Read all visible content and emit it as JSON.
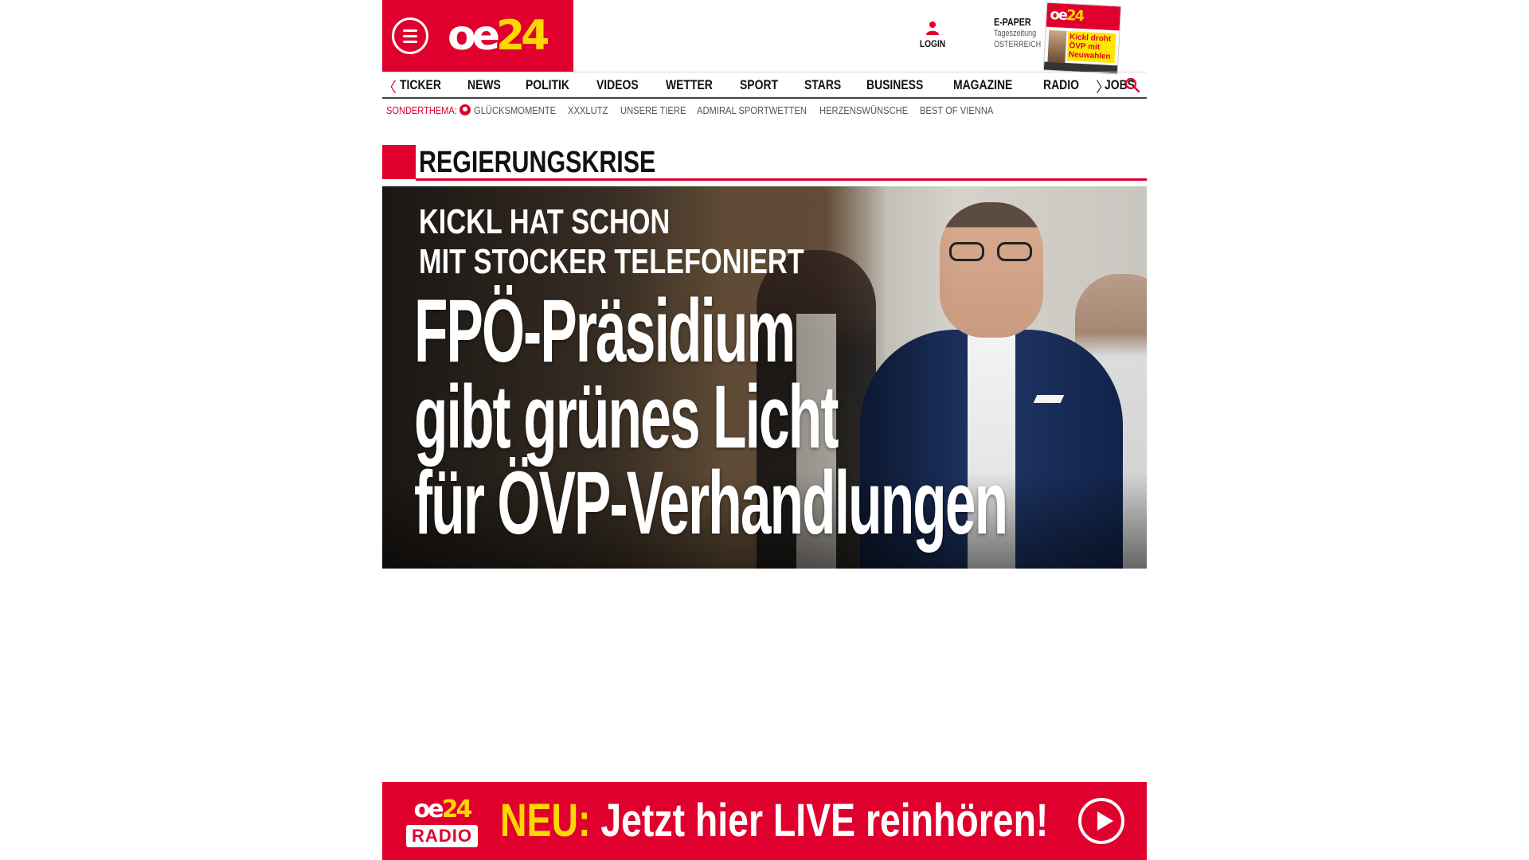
{
  "header": {
    "logo_oe": "oe",
    "logo_num": "24",
    "login_label": "LOGIN",
    "epaper": {
      "title": "E-PAPER",
      "subtitle_1": "Tageszeitung",
      "subtitle_2": "ÖSTERREICH"
    },
    "cover_headline": "Kickl droht ÖVP mit Neuwahlen"
  },
  "nav": {
    "items": [
      "TICKER",
      "NEWS",
      "POLITIK",
      "VIDEOS",
      "WETTER",
      "SPORT",
      "STARS",
      "BUSINESS",
      "MAGAZINE",
      "RADIO",
      "JOBS"
    ],
    "prev_arrow": "〈",
    "next_arrow": "〉"
  },
  "special_topics": {
    "label": "SONDERTHEMA:",
    "items": [
      "GLÜCKSMOMENTE",
      "XXXLUTZ",
      "UNSERE TIERE",
      "ADMIRAL SPORTWETTEN",
      "HERZENSWÜNSCHE",
      "BEST OF VIENNA"
    ]
  },
  "section": {
    "title": "REGIERUNGSKRISE"
  },
  "hero": {
    "kicker_line_1": "KICKL HAT SCHON",
    "kicker_line_2": "MIT STOCKER TELEFONIERT",
    "headline_line_1": "FPÖ-Präsidium",
    "headline_line_2": "gibt grünes Licht",
    "headline_line_3": "für ÖVP-Verhandlungen"
  },
  "radio_banner": {
    "logo_oe": "oe",
    "logo_num": "24",
    "logo_radio": "RADIO",
    "new_label": "NEU:",
    "cta": "Jetzt hier LIVE reinhören!"
  },
  "colors": {
    "brand_red": "#e0002e",
    "brand_yellow": "#ffd700",
    "text_dark": "#111111",
    "text_muted": "#555555"
  }
}
